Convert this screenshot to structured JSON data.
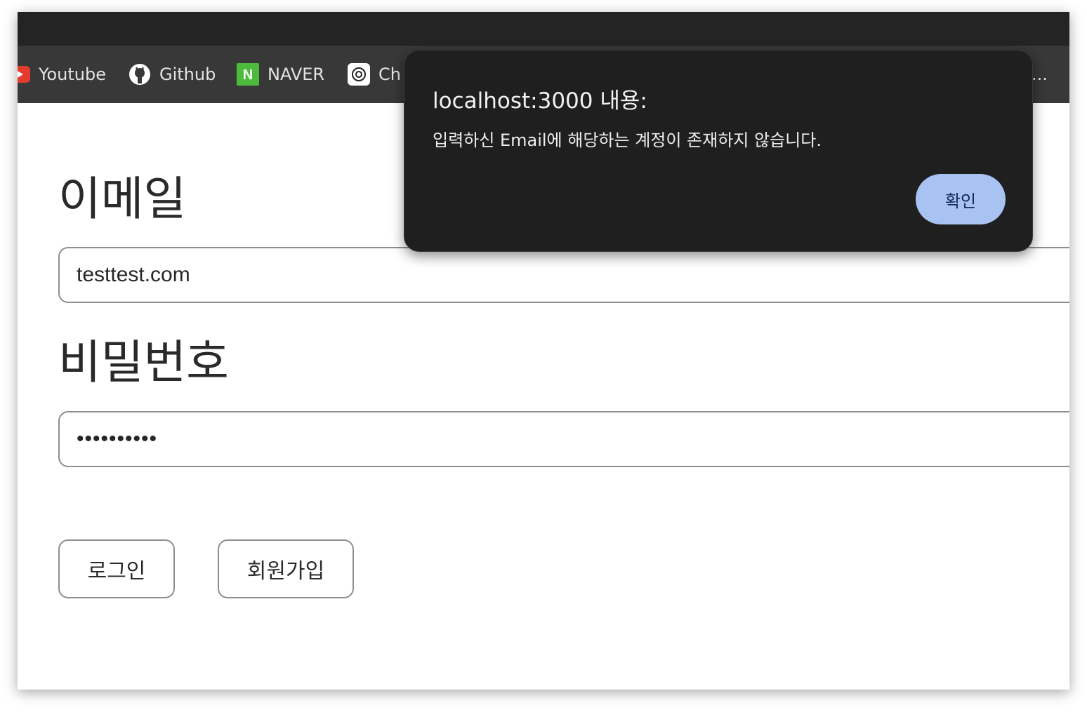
{
  "bookmarks": {
    "items": [
      {
        "label": "Youtube",
        "icon": "youtube-icon"
      },
      {
        "label": "Github",
        "icon": "github-icon"
      },
      {
        "label": "NAVER",
        "icon": "naver-icon"
      },
      {
        "label": "Ch",
        "icon": "chatgpt-icon"
      }
    ],
    "overflow_text": "...",
    "colors": {
      "bar": "#383838",
      "text": "#e3e3e3",
      "naver": "#4cbb3c",
      "youtube": "#e53b2f"
    }
  },
  "form": {
    "email_label": "이메일",
    "email_value": "testtest.com",
    "password_label": "비밀번호",
    "password_value": "••••••••••",
    "login_button": "로그인",
    "signup_button": "회원가입"
  },
  "dialog": {
    "title": "localhost:3000 내용:",
    "message": "입력하신 Email에 해당하는 계정이 존재하지 않습니다.",
    "ok_button": "확인",
    "colors": {
      "background": "#1f1f1f",
      "button": "#a8c2f2",
      "button_text": "#0f2a5a"
    }
  }
}
